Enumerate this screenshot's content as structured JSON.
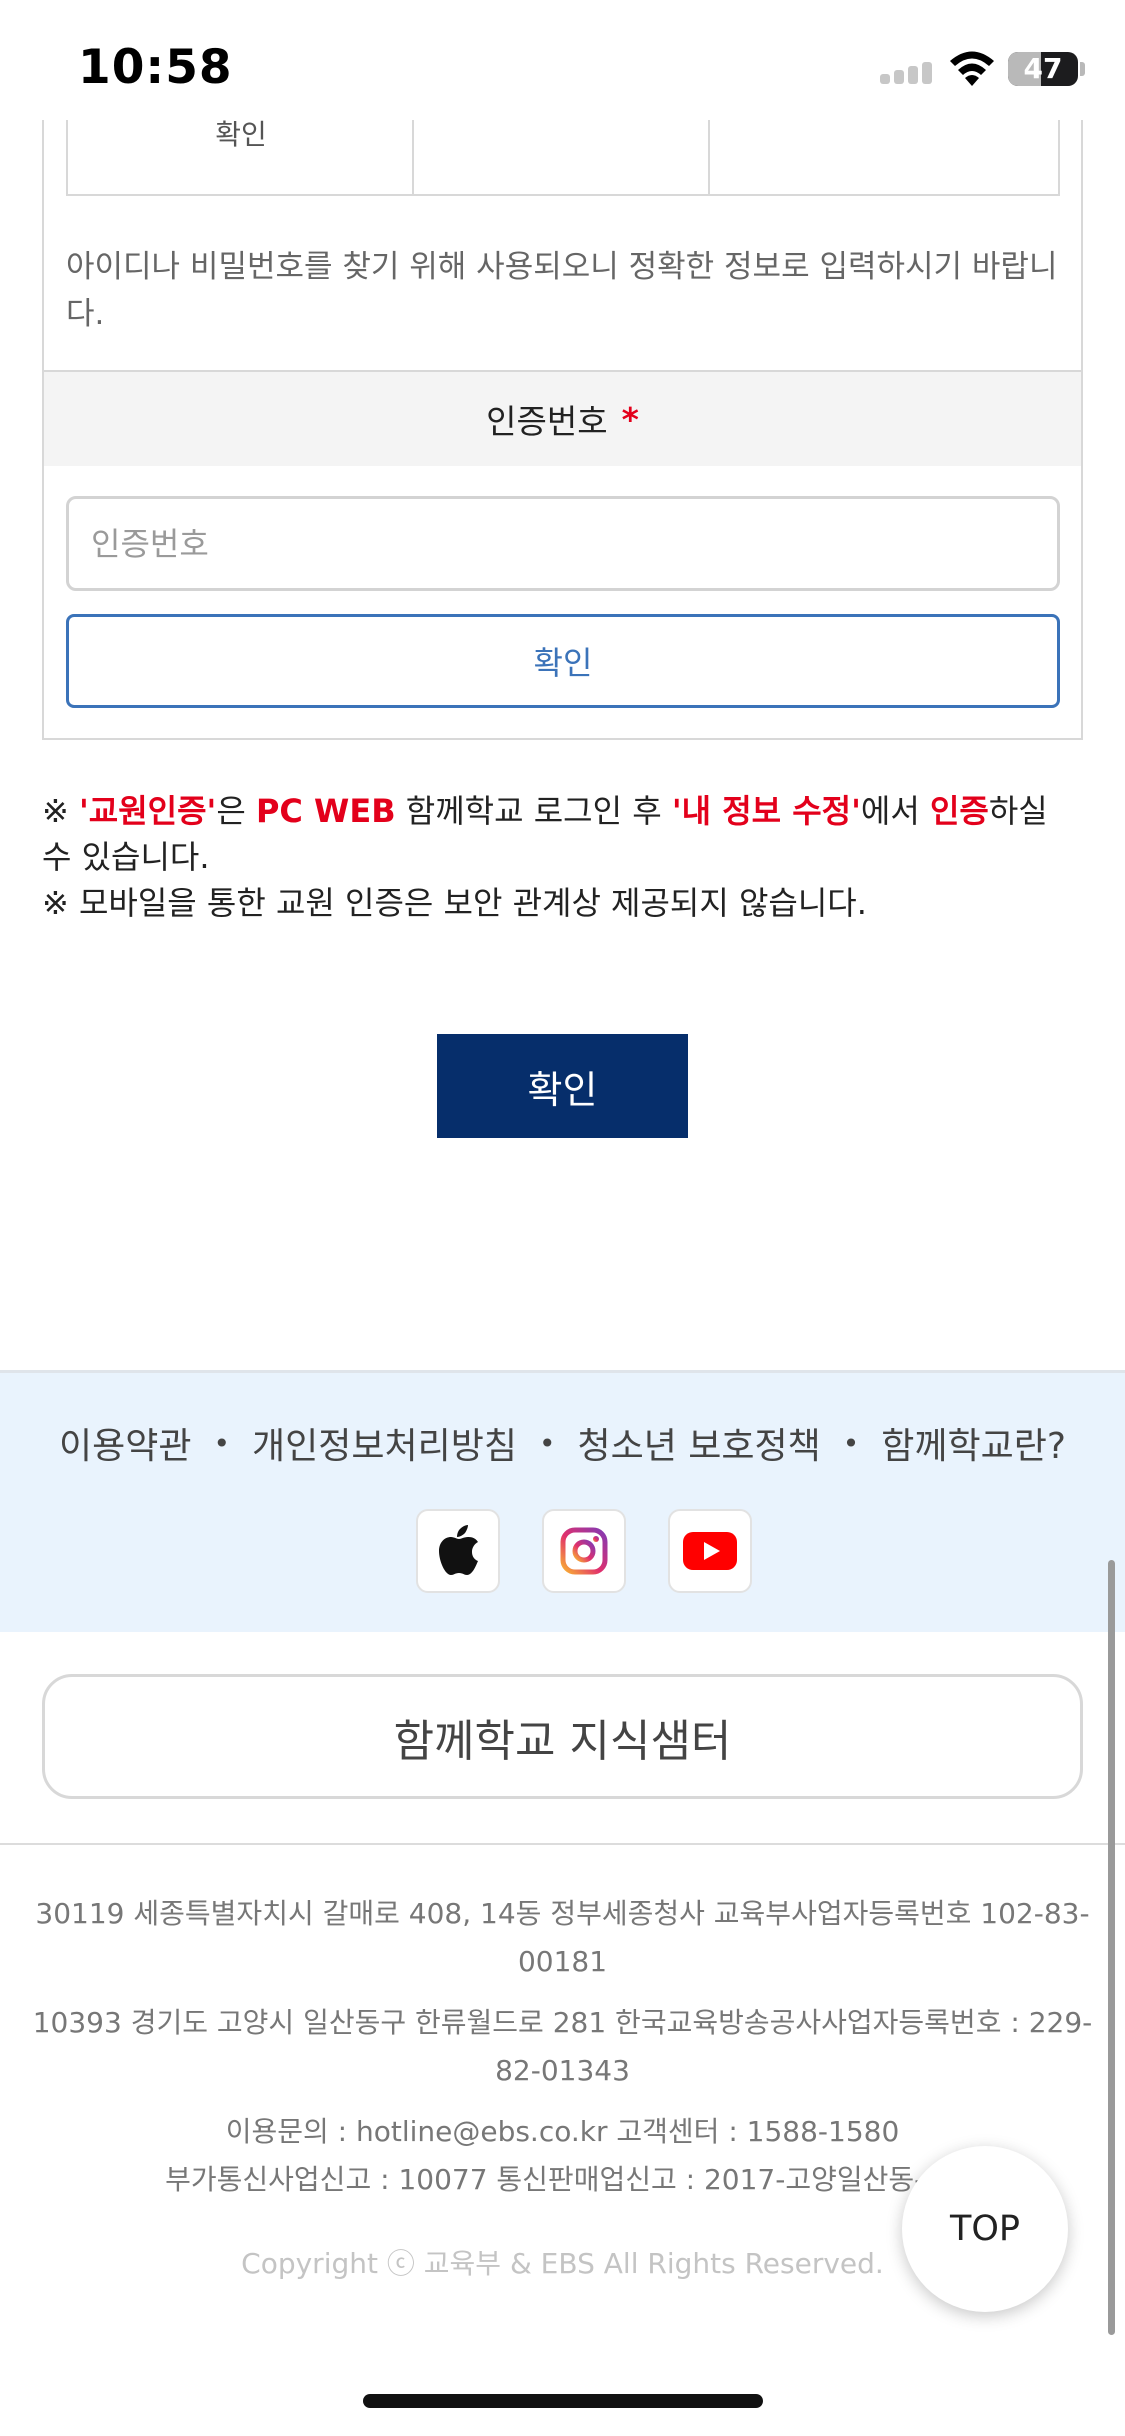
{
  "status_bar": {
    "time": "10:58",
    "battery": "47",
    "battery_level_percent": 47
  },
  "form": {
    "top_table_label": "확인",
    "hint": "아이디나 비밀번호를 찾기 위해 사용되오니 정확한 정보로 입력하시기 바랍니다.",
    "cert_label": "인증번호",
    "required_mark": "*",
    "cert_input_placeholder": "인증번호",
    "cert_input_value": "",
    "cert_confirm_label": "확인"
  },
  "notice": {
    "mark": "※",
    "teacher_auth": "'교원인증'",
    "particle1": "은",
    "pc_web": "PC WEB",
    "text_mid": "함께학교 로그인 후",
    "my_info": "'내 정보 수정'",
    "particle2": "에서",
    "auth": "인증",
    "text_end": "하실 수 있습니다.",
    "line2": "※ 모바일을 통한 교원 인증은 보안 관계상 제공되지 않습니다."
  },
  "main_confirm_label": "확인",
  "footer": {
    "links": [
      "이용약관",
      "개인정보처리방침",
      "청소년 보호정책",
      "함께학교란?"
    ],
    "link_separator": "•",
    "social_icons": [
      "apple-icon",
      "instagram-icon",
      "youtube-icon"
    ],
    "knowledge_center": "함께학교 지식샘터",
    "address1": "30119 세종특별자치시 갈매로 408, 14동 정부세종청사 교육부사업자등록번호 102-83-00181",
    "address2": "10393 경기도 고양시 일산동구 한류월드로 281 한국교육방송공사사업자등록번호 : 229-82-01343",
    "contact": "이용문의 : hotline@ebs.co.kr   고객센터 : 1588-1580",
    "registration": "부가통신사업신고 : 10077   통신판매업신고 : 2017-고양일산동-14",
    "copyright": "Copyright ⓒ 교육부 & EBS All Rights Reserved."
  },
  "top_button": "TOP",
  "colors": {
    "navy": "#062e6b",
    "link_blue": "#3b73b9",
    "red": "#e3001b",
    "footer_bg": "#e9f3fd"
  }
}
